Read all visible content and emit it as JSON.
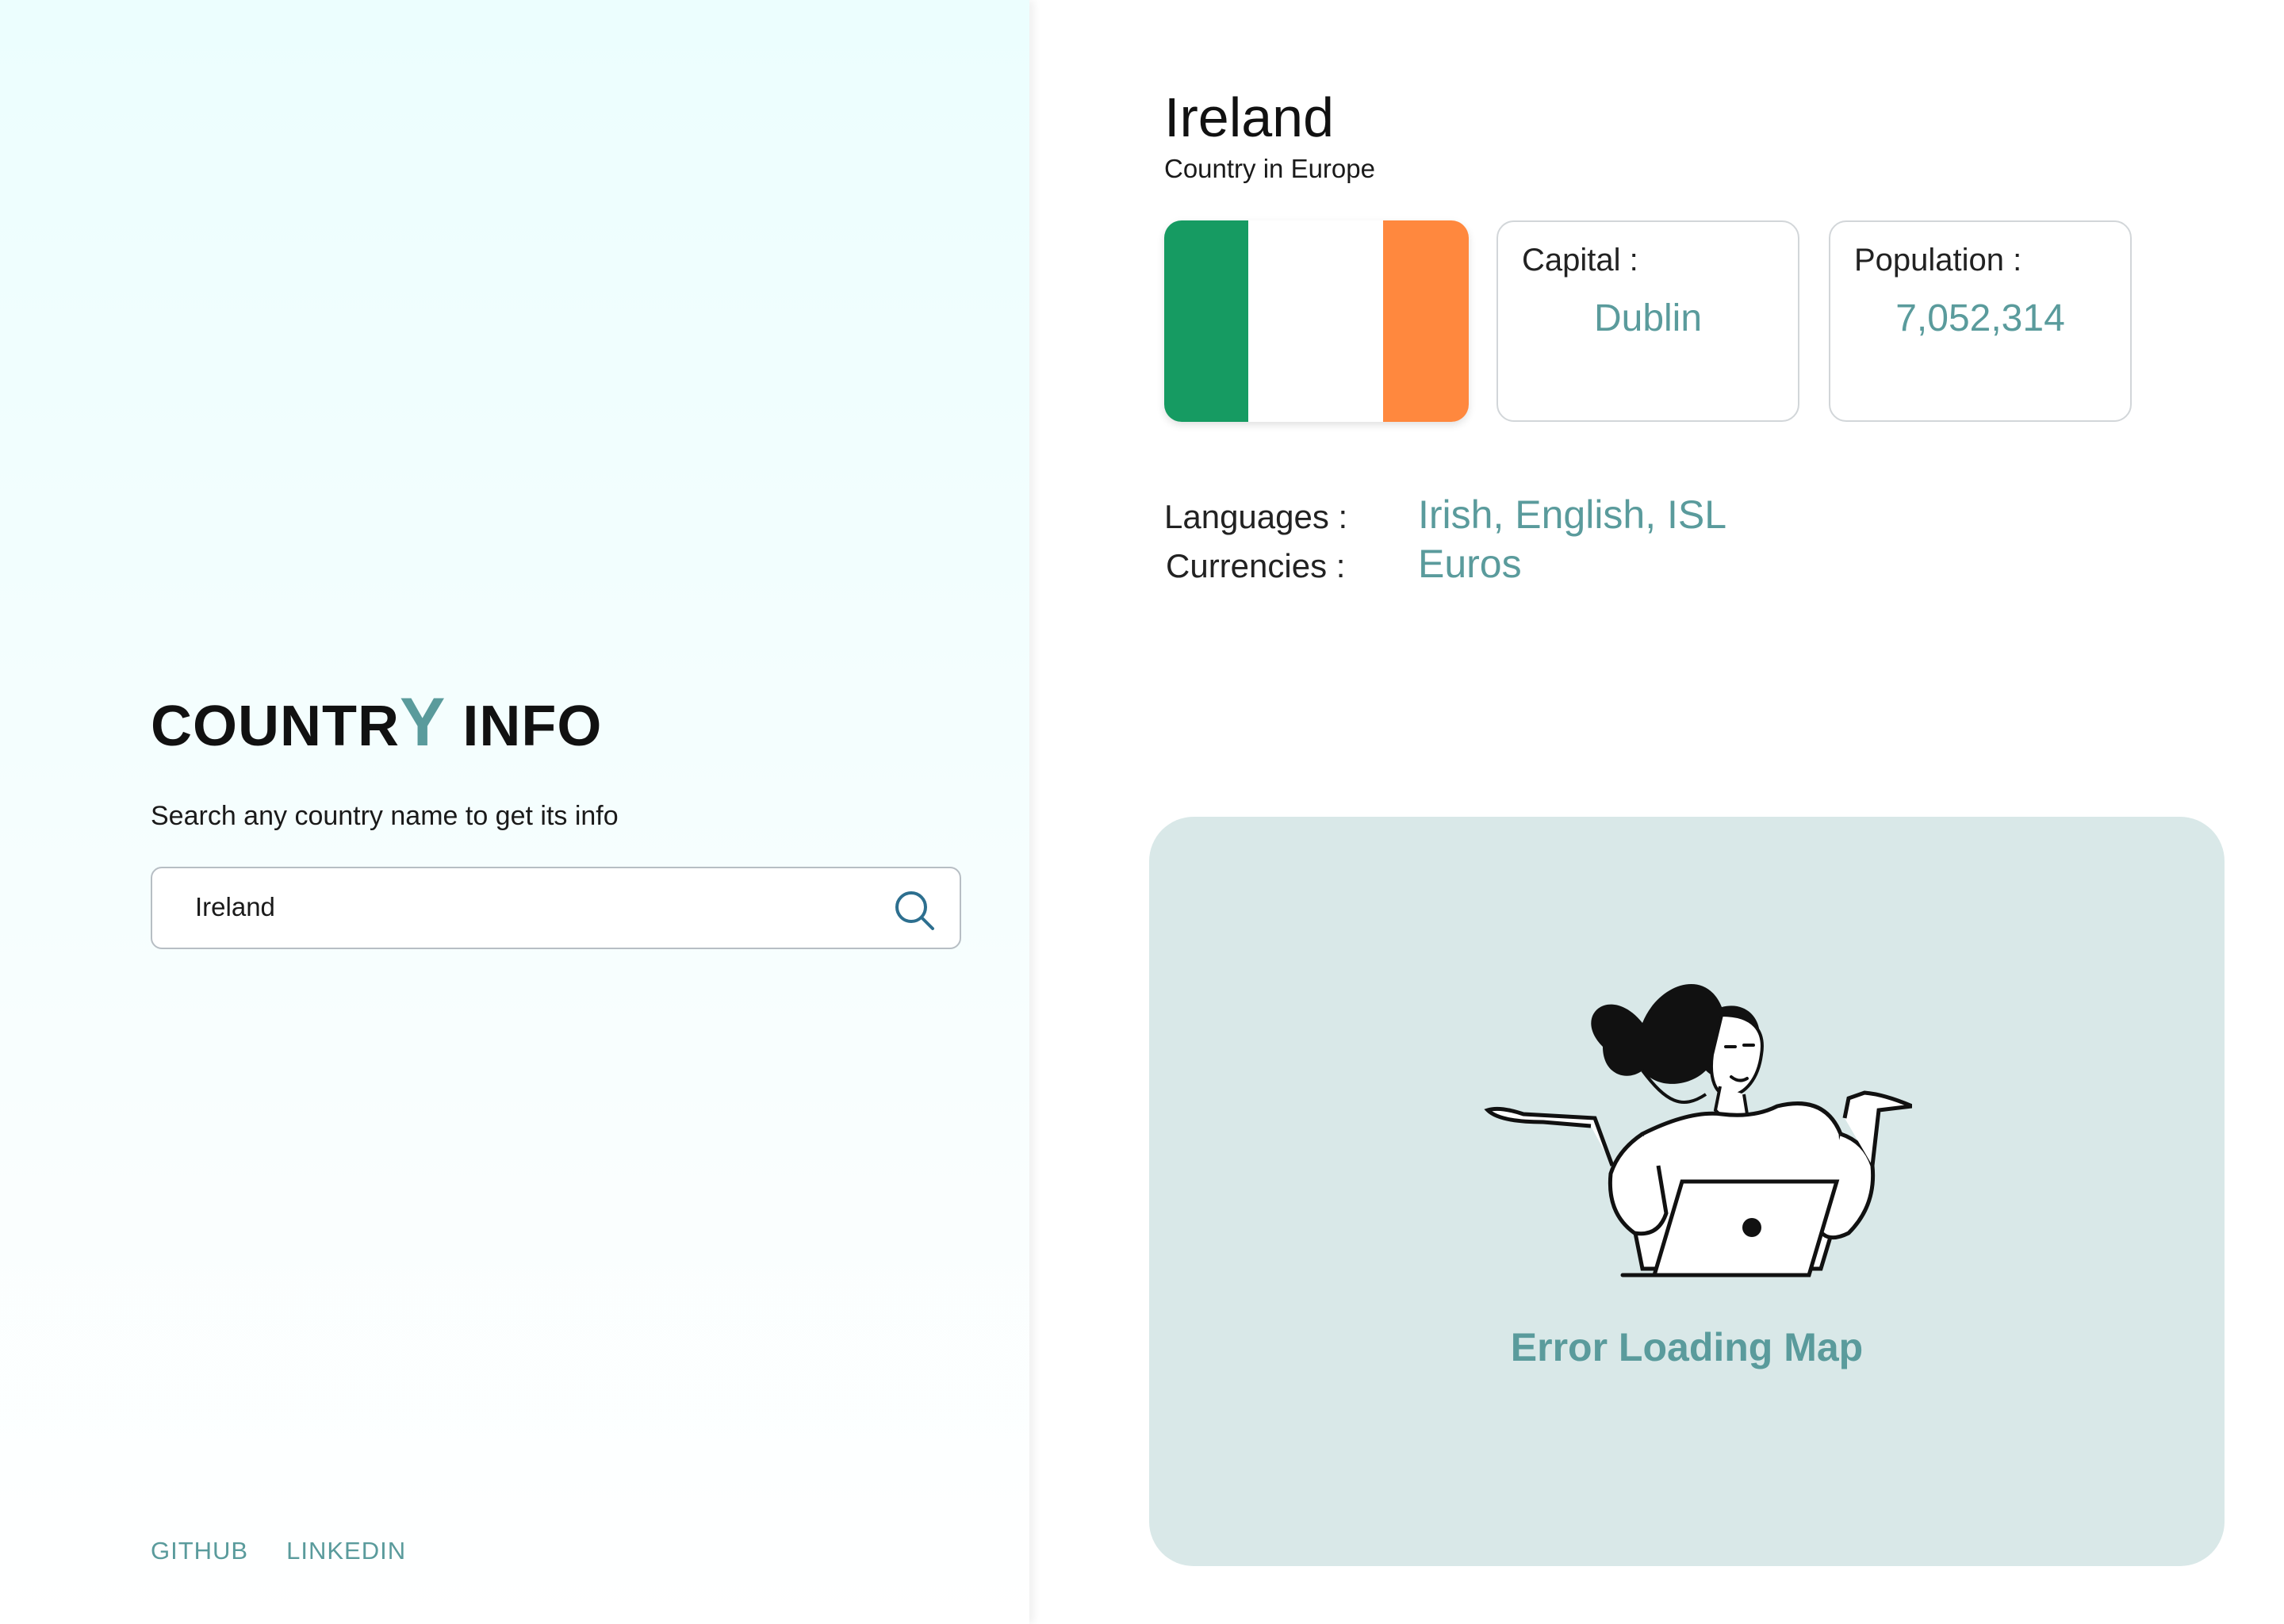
{
  "brand": {
    "title_prefix": "COUNTR",
    "title_accent": "Y",
    "title_suffix": " INFO"
  },
  "search": {
    "tagline": "Search any country name to get its info",
    "value": "Ireland",
    "icon": "search-icon"
  },
  "footer": {
    "github": "GITHUB",
    "linkedin": "LINKEDIN"
  },
  "country": {
    "name": "Ireland",
    "subtitle": "Country in Europe",
    "flag_colors": [
      "#169b62",
      "#ffffff",
      "#ff883e"
    ],
    "capital_label": "Capital :",
    "capital": "Dublin",
    "population_label": "Population :",
    "population": "7,052,314",
    "languages_label": "Languages :",
    "languages": "Irish,  English, ISL",
    "currencies_label": "Currencies :",
    "currencies": "Euros"
  },
  "map": {
    "error": "Error Loading Map"
  },
  "colors": {
    "accent": "#5a9b9c",
    "map_bg": "#d9e8e8"
  }
}
